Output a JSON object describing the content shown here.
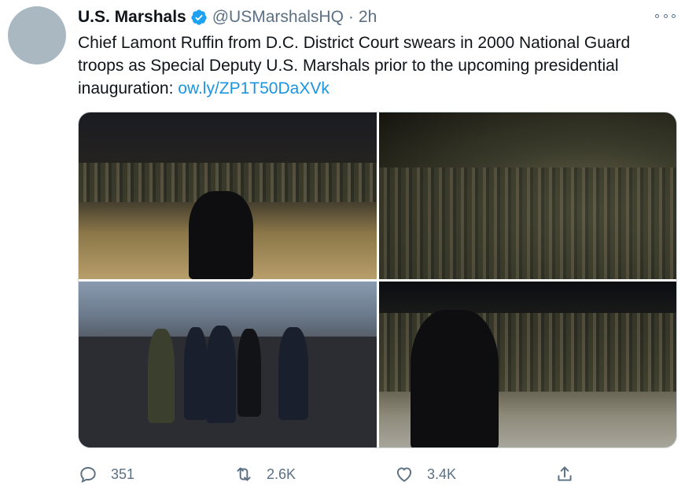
{
  "tweet": {
    "display_name": "U.S. Marshals",
    "handle": "@USMarshalsHQ",
    "separator": "·",
    "time": "2h",
    "text": "Chief Lamont Ruffin from D.C. District Court swears in 2000 National Guard troops as Special Deputy U.S. Marshals prior to the upcoming presidential inauguration: ",
    "link": "ow.ly/ZP1T50DaXVk",
    "verified_icon": "verified-badge-icon",
    "accent_color": "#1b95e0"
  },
  "media": {
    "photo_count": 4
  },
  "actions": {
    "reply_count": "351",
    "retweet_count": "2.6K",
    "like_count": "3.4K"
  },
  "colors": {
    "text": "#0f1419",
    "secondary": "#5b7083",
    "link": "#1b95e0"
  }
}
